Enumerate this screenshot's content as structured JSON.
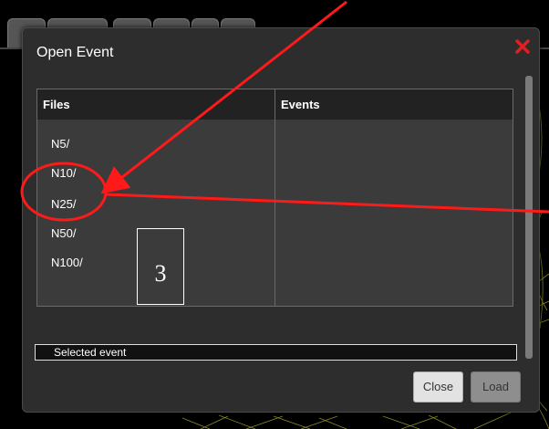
{
  "dialog": {
    "title": "Open Event",
    "close_icon": "close-icon"
  },
  "table": {
    "files_header": "Files",
    "events_header": "Events",
    "files": [
      "N5/",
      "N10/",
      "N25/",
      "N50/",
      "N100/"
    ]
  },
  "selected_event": "Selected event",
  "buttons": {
    "close": "Close",
    "load": "Load"
  },
  "annotation": {
    "number": "3"
  },
  "colors": {
    "accent_close": "#e02020",
    "annotation": "#ff1a1a",
    "background_wire": "#c8c840"
  }
}
